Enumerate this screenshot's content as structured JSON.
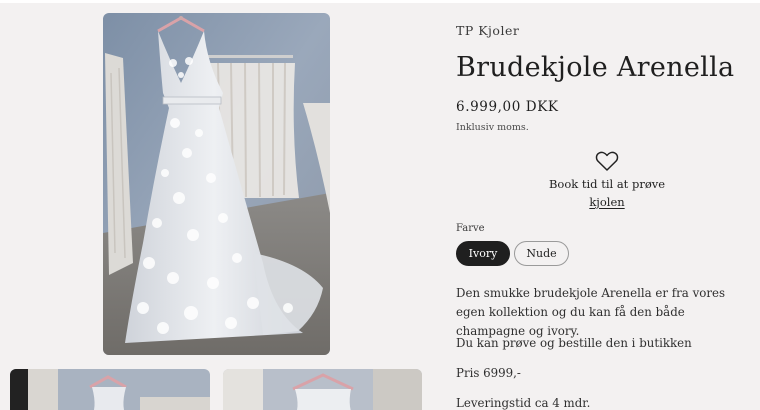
{
  "product": {
    "vendor": "TP Kjoler",
    "title": "Brudekjole Arenella",
    "price": "6.999,00 DKK",
    "tax_note": "Inklusiv moms."
  },
  "booking": {
    "line1": "Book tid til at prøve",
    "line2": "kjolen"
  },
  "color_option": {
    "label": "Farve",
    "options": [
      "Ivory",
      "Nude"
    ],
    "selected": "Ivory"
  },
  "description": {
    "p1": "Den smukke brudekjole Arenella er fra vores egen kollektion og du kan få den både champagne og ivory.",
    "p2": "Du kan prøve og bestille den i butikken",
    "p3": "Pris 6999,-",
    "p4": "Leveringstid ca 4 mdr."
  },
  "icons": {
    "wishlist": "heart-icon"
  },
  "colors": {
    "background": "#f3f1f1",
    "active_pill": "#1f1f1f",
    "text": "#2b2b2b"
  }
}
